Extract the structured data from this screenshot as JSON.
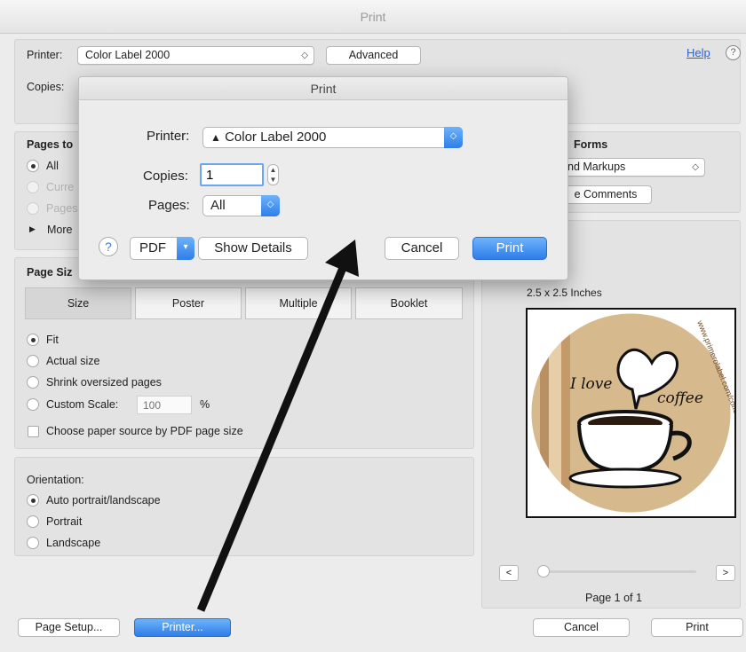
{
  "window": {
    "title": "Print"
  },
  "header": {
    "printer_label": "Printer:",
    "printer_value": "Color Label 2000",
    "advanced_label": "Advanced",
    "copies_label": "Copies:",
    "help_label": "Help",
    "help_icon": "?"
  },
  "pages_to_print": {
    "title": "Pages to",
    "options": [
      "All",
      "Curre",
      "Pages"
    ],
    "more_label": "More"
  },
  "comments_forms": {
    "title": "Forms",
    "select_value": "nd Markups",
    "button_label": "e Comments"
  },
  "page_sizing": {
    "title": "Page Siz",
    "tabs": [
      "Size",
      "Poster",
      "Multiple",
      "Booklet"
    ],
    "options": [
      "Fit",
      "Actual size",
      "Shrink oversized pages",
      "Custom Scale:"
    ],
    "scale_placeholder": "100",
    "scale_unit": "%",
    "paper_source_label": "Choose paper source by PDF page size"
  },
  "orientation": {
    "title": "Orientation:",
    "options": [
      "Auto portrait/landscape",
      "Portrait",
      "Landscape"
    ]
  },
  "preview": {
    "size_label": "2.5 x 2.5 Inches",
    "page_label": "Page 1 of 1",
    "prev_label": "<",
    "next_label": ">",
    "label_text": {
      "i_love": "I love",
      "coffee": "coffee",
      "url": "www.primerolabel.com/coffee-labels.html"
    }
  },
  "footer": {
    "page_setup_label": "Page Setup...",
    "printer_label": "Printer...",
    "cancel_label": "Cancel",
    "print_label": "Print"
  },
  "sheet": {
    "title": "Print",
    "printer_label": "Printer:",
    "printer_value": "Color Label 2000",
    "printer_warning_icon": "▲",
    "copies_label": "Copies:",
    "copies_value": "1",
    "pages_label": "Pages:",
    "pages_value": "All",
    "help_icon": "?",
    "pdf_label": "PDF",
    "show_details_label": "Show Details",
    "cancel_label": "Cancel",
    "print_label": "Print"
  },
  "colors": {
    "accent_blue": "#2f7de8",
    "arrow": "#111111"
  }
}
